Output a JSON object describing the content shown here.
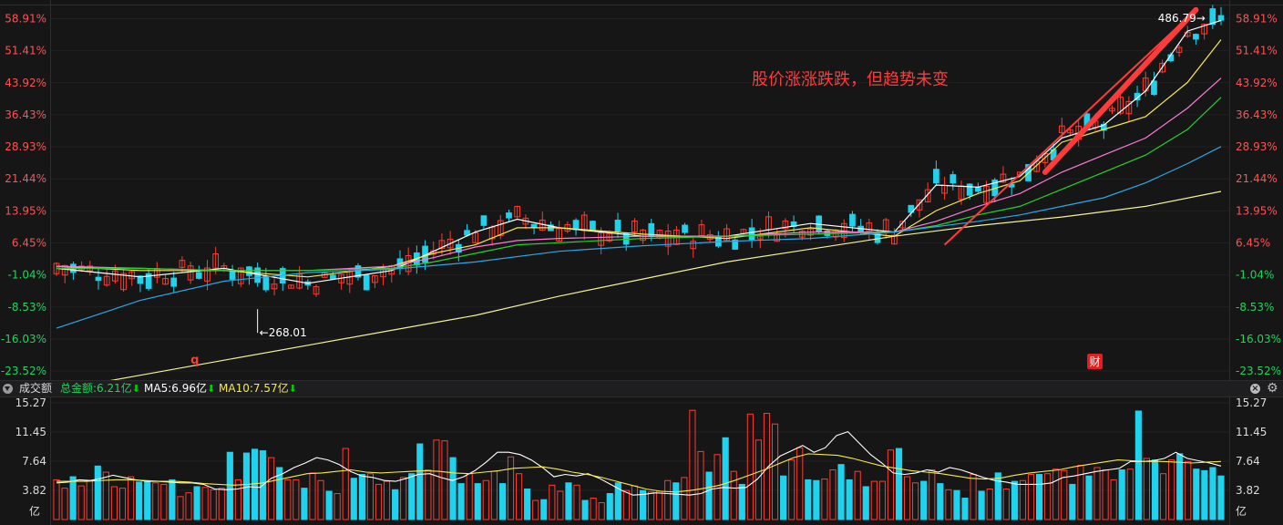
{
  "colors": {
    "background": "#161617",
    "up": "#ff3b30",
    "down": "#1fd2ee",
    "axis_up": "#ff5252",
    "axis_down": "#23d35a",
    "ma_white": "#ffffff",
    "ma_yellow": "#f5e94a",
    "ma_pink": "#ff7ad6",
    "ma_green": "#28d02c",
    "ma_blue": "#2ea6e6",
    "ma_pale_yellow": "#f1f09a",
    "annotation_red": "#ff3b3b"
  },
  "chart_data": [
    {
      "type": "candlestick",
      "y_ticks_pct": [
        "58.91%",
        "51.41%",
        "43.92%",
        "36.43%",
        "28.93%",
        "21.44%",
        "13.95%",
        "6.45%",
        "-1.04%",
        "-8.53%",
        "-16.03%",
        "-23.52%"
      ],
      "ylim_pct": [
        -25.0,
        62.0
      ],
      "annotation": "股价涨涨跌跌，但趋势未变",
      "low_label": "←268.01",
      "low_marker": {
        "index": 24,
        "value_pct": -9.9
      },
      "high_label": "486.79→",
      "high_marker": {
        "index": 138,
        "value_pct": 60.5
      },
      "marker_q": "q",
      "marker_cai": "财",
      "marker_q_index": 16,
      "marker_cai_index": 124,
      "n_candles": 140,
      "series": [
        {
          "name": "",
          "color": "#ffffff",
          "points": [
            [
              0,
              0.5
            ],
            [
              10,
              -1.5
            ],
            [
              20,
              0.5
            ],
            [
              30,
              -3
            ],
            [
              40,
              0
            ],
            [
              50,
              9
            ],
            [
              55,
              12
            ],
            [
              60,
              10
            ],
            [
              70,
              8
            ],
            [
              80,
              8
            ],
            [
              90,
              11
            ],
            [
              100,
              9
            ],
            [
              105,
              20
            ],
            [
              110,
              19.5
            ],
            [
              115,
              22
            ],
            [
              120,
              31
            ],
            [
              125,
              34
            ],
            [
              130,
              42
            ],
            [
              135,
              56
            ],
            [
              139,
              58.5
            ]
          ]
        },
        {
          "name": "",
          "color": "#f5e94a",
          "points": [
            [
              0,
              1
            ],
            [
              10,
              0
            ],
            [
              20,
              0
            ],
            [
              30,
              -1.5
            ],
            [
              40,
              1
            ],
            [
              45,
              4
            ],
            [
              50,
              6
            ],
            [
              55,
              10
            ],
            [
              60,
              10
            ],
            [
              70,
              8.5
            ],
            [
              80,
              7.5
            ],
            [
              90,
              10
            ],
            [
              100,
              8
            ],
            [
              105,
              14
            ],
            [
              110,
              18
            ],
            [
              115,
              21
            ],
            [
              120,
              30
            ],
            [
              125,
              33
            ],
            [
              130,
              36
            ],
            [
              135,
              44
            ],
            [
              139,
              54
            ]
          ]
        },
        {
          "name": "",
          "color": "#ff7ad6",
          "points": [
            [
              0,
              1
            ],
            [
              10,
              0.5
            ],
            [
              20,
              0
            ],
            [
              30,
              0
            ],
            [
              40,
              1
            ],
            [
              45,
              3
            ],
            [
              50,
              5.5
            ],
            [
              55,
              7
            ],
            [
              60,
              7.5
            ],
            [
              70,
              8
            ],
            [
              80,
              8
            ],
            [
              90,
              9
            ],
            [
              100,
              9
            ],
            [
              105,
              11.5
            ],
            [
              110,
              15
            ],
            [
              115,
              18
            ],
            [
              120,
              23
            ],
            [
              125,
              27
            ],
            [
              130,
              31
            ],
            [
              135,
              38
            ],
            [
              139,
              45
            ]
          ]
        },
        {
          "name": "",
          "color": "#28d02c",
          "points": [
            [
              0,
              0.5
            ],
            [
              10,
              0.5
            ],
            [
              20,
              0
            ],
            [
              30,
              0
            ],
            [
              40,
              0.5
            ],
            [
              45,
              2
            ],
            [
              50,
              4
            ],
            [
              55,
              6
            ],
            [
              60,
              6.5
            ],
            [
              70,
              7.5
            ],
            [
              80,
              8
            ],
            [
              90,
              8.5
            ],
            [
              100,
              9
            ],
            [
              105,
              10.5
            ],
            [
              110,
              13
            ],
            [
              115,
              15
            ],
            [
              120,
              19
            ],
            [
              125,
              23
            ],
            [
              130,
              27
            ],
            [
              135,
              33
            ],
            [
              139,
              40.5
            ]
          ]
        },
        {
          "name": "",
          "color": "#2ea6e6",
          "points": [
            [
              0,
              -13.5
            ],
            [
              10,
              -7
            ],
            [
              20,
              -2.5
            ],
            [
              30,
              -0.5
            ],
            [
              40,
              0.3
            ],
            [
              50,
              2
            ],
            [
              60,
              4.5
            ],
            [
              70,
              5.8
            ],
            [
              80,
              6.8
            ],
            [
              90,
              7.5
            ],
            [
              100,
              9
            ],
            [
              110,
              11.5
            ],
            [
              115,
              13
            ],
            [
              120,
              15
            ],
            [
              125,
              17
            ],
            [
              130,
              20.5
            ],
            [
              135,
              25
            ],
            [
              139,
              29
            ]
          ]
        },
        {
          "name": "",
          "color": "#f1f09a",
          "points": [
            [
              0,
              -28
            ],
            [
              10,
              -24.5
            ],
            [
              20,
              -21
            ],
            [
              30,
              -17.5
            ],
            [
              40,
              -14
            ],
            [
              50,
              -10.5
            ],
            [
              60,
              -6
            ],
            [
              70,
              -2
            ],
            [
              80,
              2
            ],
            [
              90,
              5
            ],
            [
              100,
              8
            ],
            [
              110,
              10.5
            ],
            [
              120,
              12.5
            ],
            [
              130,
              15
            ],
            [
              139,
              18.5
            ]
          ]
        }
      ]
    },
    {
      "type": "bar",
      "label": "成交额",
      "total_label": "总金额:6.21亿",
      "ma5_label": "MA5:6.96亿",
      "ma10_label": "MA10:7.57亿",
      "unit": "亿",
      "y_ticks": [
        "15.27",
        "11.45",
        "7.64",
        "3.82"
      ],
      "ylim": [
        0,
        15.27
      ],
      "values": [
        5.2,
        4.1,
        5.6,
        4.4,
        5.1,
        7.0,
        6.2,
        4.3,
        4.1,
        5.6,
        4.9,
        5.0,
        4.8,
        4.6,
        5.2,
        3.0,
        3.5,
        4.3,
        4.2,
        3.9,
        4.1,
        8.8,
        5.2,
        8.7,
        9.2,
        9.0,
        8.1,
        6.8,
        5.2,
        5.2,
        4.1,
        6.1,
        5.1,
        3.7,
        3.4,
        9.3,
        5.4,
        5.9,
        6.0,
        4.6,
        5.0,
        3.9,
        5.5,
        6.0,
        9.9,
        6.5,
        10.4,
        10.3,
        8.1,
        4.7,
        6.0,
        4.7,
        5.1,
        6.3,
        4.7,
        8.2,
        6.0,
        4.0,
        2.5,
        2.6,
        4.5,
        3.7,
        4.8,
        4.5,
        2.5,
        2.8,
        2.2,
        3.4,
        4.8,
        3.8,
        4.4,
        3.8,
        3.6,
        3.7,
        5.1,
        4.8,
        5.5,
        14.3,
        8.9,
        6.2,
        8.5,
        10.7,
        6.3,
        4.6,
        13.8,
        10.4,
        13.9,
        12.5,
        5.7,
        7.8,
        9.4,
        5.2,
        5.1,
        5.3,
        6.5,
        7.2,
        5.2,
        6.3,
        4.3,
        5.0,
        5.0,
        9.1,
        9.3,
        5.6,
        4.8,
        5.0,
        6.5,
        4.7,
        3.9,
        3.8,
        2.8,
        5.9,
        3.7,
        4.0,
        6.1,
        4.0,
        5.0,
        5.1,
        5.9,
        5.9,
        6.0,
        6.6,
        6.4,
        4.6,
        7.1,
        5.7,
        6.8,
        6.5,
        5.2,
        6.5,
        6.6,
        14.2,
        8.0,
        7.8,
        6.0,
        7.8,
        8.6,
        7.6,
        6.6,
        6.4,
        6.8,
        5.7
      ],
      "up_flags": [
        1,
        1,
        0,
        1,
        1,
        0,
        1,
        1,
        1,
        1,
        0,
        0,
        1,
        1,
        0,
        1,
        1,
        0,
        1,
        1,
        1,
        0,
        1,
        0,
        0,
        0,
        1,
        0,
        1,
        1,
        0,
        1,
        1,
        0,
        1,
        1,
        0,
        0,
        1,
        1,
        1,
        0,
        1,
        0,
        0,
        1,
        1,
        1,
        0,
        0,
        1,
        0,
        1,
        1,
        0,
        1,
        1,
        0,
        1,
        0,
        1,
        1,
        0,
        1,
        0,
        1,
        1,
        0,
        0,
        1,
        1,
        0,
        1,
        1,
        1,
        0,
        1,
        1,
        1,
        0,
        1,
        0,
        1,
        0,
        1,
        1,
        1,
        1,
        0,
        1,
        1,
        0,
        0,
        1,
        1,
        0,
        0,
        1,
        0,
        1,
        1,
        1,
        0,
        1,
        1,
        0,
        1,
        0,
        1,
        0,
        0,
        1,
        0,
        1,
        0,
        1,
        0,
        1,
        1,
        0,
        1,
        1,
        1,
        0,
        1,
        0,
        1,
        1,
        1,
        0,
        1,
        0,
        1,
        0,
        1,
        1,
        0,
        1,
        0,
        0
      ],
      "ma5": [
        4.8,
        4.9,
        5.2,
        5.1,
        5.4,
        5.8,
        5.5,
        5.2,
        5.0,
        5.0,
        4.9,
        4.8,
        4.8,
        4.6,
        4.0,
        3.9,
        4.0,
        4.3,
        4.2,
        5.4,
        6.0,
        6.8,
        7.4,
        8.1,
        7.8,
        7.2,
        6.3,
        5.7,
        5.5,
        5.1,
        5.0,
        5.4,
        5.9,
        6.0,
        5.5,
        5.1,
        5.6,
        6.4,
        7.5,
        8.8,
        8.8,
        8.5,
        7.8,
        6.8,
        5.6,
        5.9,
        5.7,
        6.0,
        5.4,
        4.6,
        3.8,
        3.2,
        3.3,
        3.5,
        3.4,
        3.3,
        3.2,
        3.4,
        4.0,
        4.2,
        4.1,
        4.2,
        5.3,
        7.0,
        8.3,
        9.0,
        9.7,
        8.8,
        9.4,
        11.0,
        11.5,
        10.0,
        8.5,
        7.4,
        6.1,
        5.9,
        6.1,
        6.5,
        6.2,
        6.8,
        6.5,
        6.0,
        5.5,
        5.1,
        4.9,
        4.6,
        4.6,
        4.6,
        4.8,
        5.5,
        5.7,
        6.0,
        6.3,
        6.5,
        6.7,
        7.6,
        7.6,
        7.7,
        8.0,
        8.8,
        8.0,
        7.7,
        7.4,
        7.0
      ],
      "ma10": [
        5.0,
        5.0,
        5.0,
        5.1,
        5.2,
        5.2,
        5.1,
        5.0,
        5.0,
        4.9,
        4.7,
        4.6,
        4.5,
        4.6,
        4.8,
        5.2,
        5.6,
        6.0,
        6.1,
        6.3,
        6.5,
        6.2,
        6.1,
        6.2,
        6.3,
        6.4,
        6.3,
        6.1,
        6.0,
        6.2,
        6.4,
        6.7,
        6.8,
        6.9,
        6.6,
        6.2,
        5.9,
        5.5,
        5.0,
        4.5,
        4.0,
        3.7,
        3.6,
        3.8,
        4.1,
        4.5,
        5.1,
        5.8,
        6.5,
        7.3,
        8.1,
        8.6,
        8.5,
        8.4,
        8.0,
        7.5,
        7.0,
        6.7,
        6.4,
        6.2,
        6.0,
        5.7,
        5.4,
        5.3,
        5.4,
        5.8,
        6.1,
        6.3,
        6.5,
        6.9,
        7.2,
        7.5,
        7.8,
        7.7,
        7.6,
        7.6,
        7.5,
        7.4,
        7.5,
        7.6
      ]
    }
  ]
}
